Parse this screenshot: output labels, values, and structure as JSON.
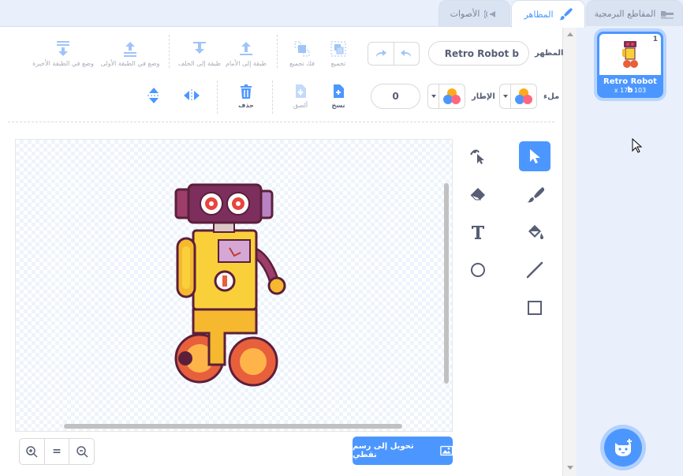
{
  "tabs": {
    "code": "المقاطع البرمجية",
    "costumes": "المظاهر",
    "sounds": "الأصوات"
  },
  "toolbar": {
    "costume_label": "المظهر",
    "costume_name": "Retro Robot b",
    "group": "تجميع",
    "ungroup": "فك تجميع",
    "forward": "طبقة إلى الأمام",
    "backward": "طبقة إلى الخلف",
    "front": "وضع في الطبقة الأولى",
    "back": "وضع في الطبقة الأخيرة",
    "fill_label": "ملء",
    "outline_label": "الإطار",
    "outline_width": "0",
    "copy": "نسخ",
    "paste": "ألصق",
    "delete": "حذف"
  },
  "sprite": {
    "index": "1",
    "name": "Retro Robot b",
    "size": "x 176 103"
  },
  "canvas": {
    "convert_label": "تحويل إلى رسم نقطي",
    "zoom_reset": "="
  },
  "colors": {
    "accent": "#4c97ff",
    "text": "#575e75",
    "background": "#e9f0fc"
  },
  "icons": [
    "code-icon",
    "brush-icon",
    "speaker-icon",
    "undo-icon",
    "redo-icon",
    "group-icon",
    "ungroup-icon",
    "layer-forward-icon",
    "layer-backward-icon",
    "layer-front-icon",
    "layer-back-icon",
    "copy-icon",
    "paste-icon",
    "trash-icon",
    "flip-horizontal-icon",
    "flip-vertical-icon",
    "select-icon",
    "reshape-icon",
    "brush-tool-icon",
    "eraser-icon",
    "fill-icon",
    "text-icon",
    "line-icon",
    "circle-icon",
    "rectangle-icon",
    "zoom-in-icon",
    "zoom-out-icon",
    "image-icon",
    "cat-add-icon"
  ]
}
